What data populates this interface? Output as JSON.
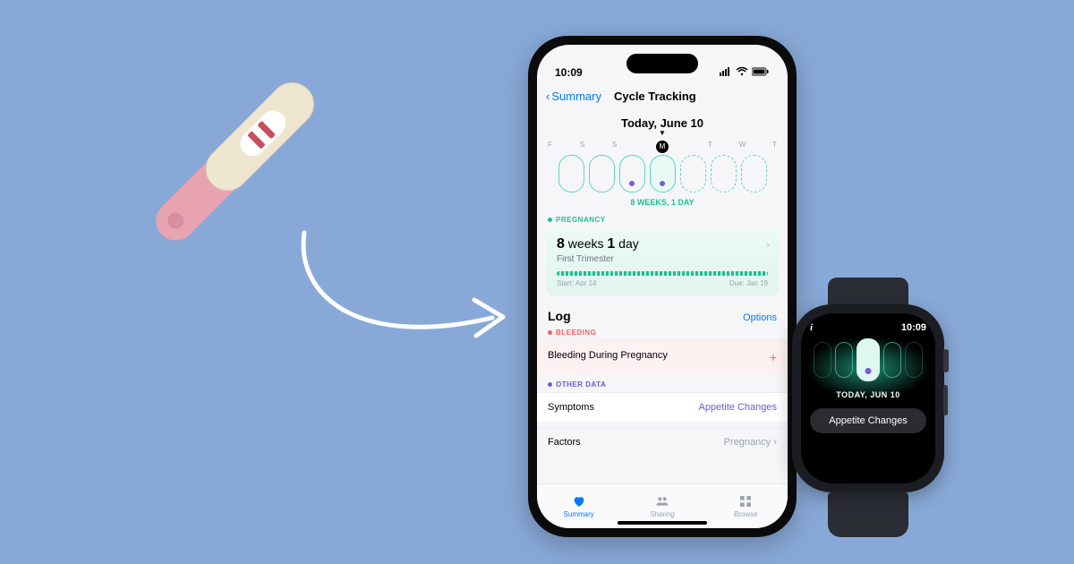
{
  "phone": {
    "status_time": "10:09",
    "nav_back": "Summary",
    "nav_title": "Cycle Tracking",
    "date_heading": "Today, June 10",
    "day_labels": [
      "F",
      "S",
      "S",
      "M",
      "T",
      "W",
      "T"
    ],
    "weeks_line": "8 WEEKS, 1 DAY",
    "pregnancy_label": "PREGNANCY",
    "preg_weeks_num": "8",
    "preg_weeks_word": "weeks",
    "preg_days_num": "1",
    "preg_days_word": "day",
    "preg_trimester": "First Trimester",
    "preg_start": "Start: Apr 14",
    "preg_due": "Due: Jan 19",
    "log_title": "Log",
    "log_options": "Options",
    "bleeding_label": "BLEEDING",
    "bleeding_row": "Bleeding During Pregnancy",
    "other_label": "OTHER DATA",
    "symptoms_row": "Symptoms",
    "symptoms_value": "Appetite Changes",
    "factors_row": "Factors",
    "factors_value": "Pregnancy",
    "tabs": {
      "summary": "Summary",
      "sharing": "Sharing",
      "browse": "Browse"
    }
  },
  "watch": {
    "time": "10:09",
    "date": "TODAY, JUN 10",
    "chip": "Appetite Changes"
  }
}
